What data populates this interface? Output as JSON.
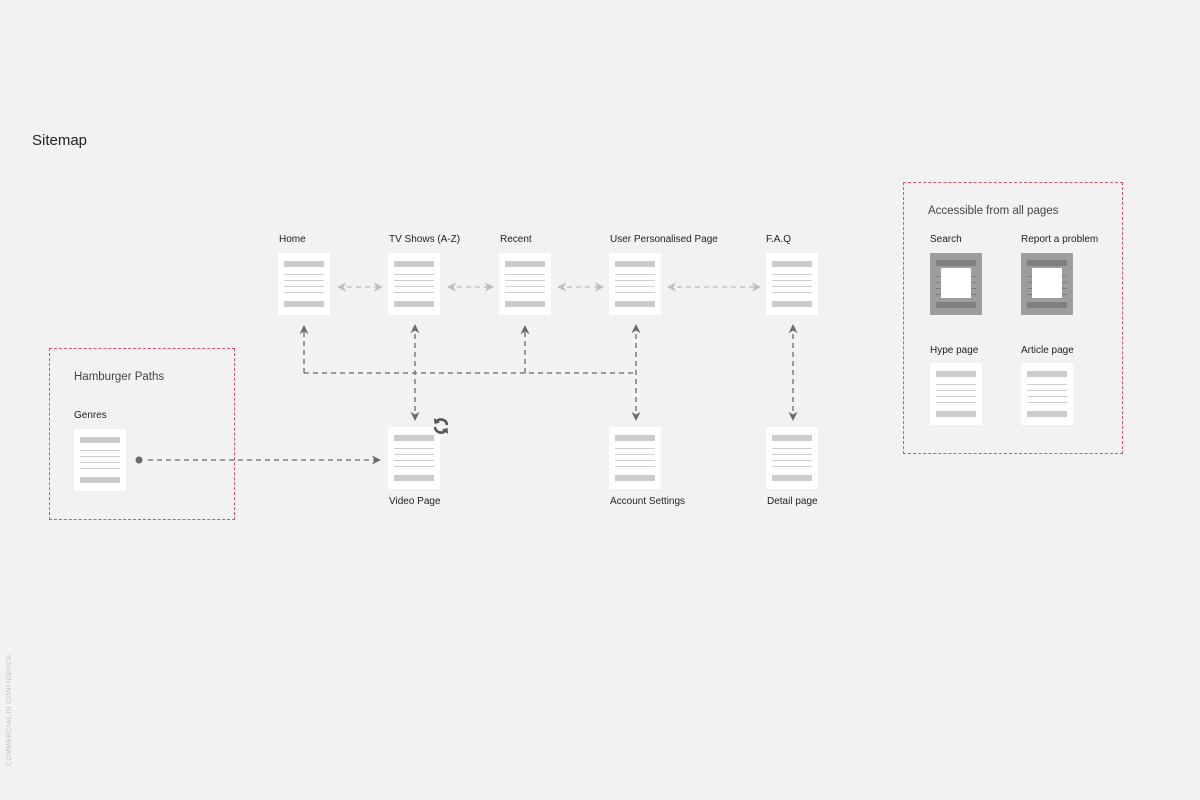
{
  "title": "Sitemap",
  "main_pages": [
    {
      "label": "Home"
    },
    {
      "label": "TV Shows (A-Z)"
    },
    {
      "label": "Recent"
    },
    {
      "label": "User Personalised Page"
    },
    {
      "label": "F.A.Q"
    }
  ],
  "sub_pages": [
    {
      "label": "Video Page",
      "icon": "refresh-icon"
    },
    {
      "label": "Account Settings"
    },
    {
      "label": "Detail page"
    }
  ],
  "hamburger_zone": {
    "title": "Hamburger Paths",
    "pages": [
      {
        "label": "Genres"
      }
    ]
  },
  "global_zone": {
    "title": "Accessible from all pages",
    "pages": [
      {
        "label": "Search",
        "style": "modal"
      },
      {
        "label": "Report a problem",
        "style": "modal"
      },
      {
        "label": "Hype page",
        "style": "page"
      },
      {
        "label": "Article page",
        "style": "page"
      }
    ]
  },
  "connections": [
    {
      "from": "Home",
      "to": "TV Shows (A-Z)",
      "type": "bidirectional-light"
    },
    {
      "from": "TV Shows (A-Z)",
      "to": "Recent",
      "type": "bidirectional-light"
    },
    {
      "from": "Recent",
      "to": "User Personalised Page",
      "type": "bidirectional-light"
    },
    {
      "from": "User Personalised Page",
      "to": "F.A.Q",
      "type": "bidirectional-light"
    },
    {
      "from": "Account Settings",
      "to": "Home",
      "type": "hub"
    },
    {
      "from": "Account Settings",
      "to": "TV Shows (A-Z)",
      "type": "hub"
    },
    {
      "from": "Account Settings",
      "to": "Recent",
      "type": "hub"
    },
    {
      "from": "Account Settings",
      "to": "User Personalised Page",
      "type": "bidirectional"
    },
    {
      "from": "TV Shows (A-Z)",
      "to": "Video Page",
      "type": "bidirectional"
    },
    {
      "from": "F.A.Q",
      "to": "Detail page",
      "type": "bidirectional"
    },
    {
      "from": "Genres",
      "to": "Video Page",
      "type": "directed"
    }
  ],
  "colors": {
    "background": "#f1f2f1",
    "zone_border": "#d9536f",
    "connector_dark": "#6a6a6a",
    "connector_light": "#bdbdbd",
    "page_bar": "#cccccc"
  },
  "footer": {
    "confidential": "COMMERCIAL IN CONFIDENCE"
  }
}
